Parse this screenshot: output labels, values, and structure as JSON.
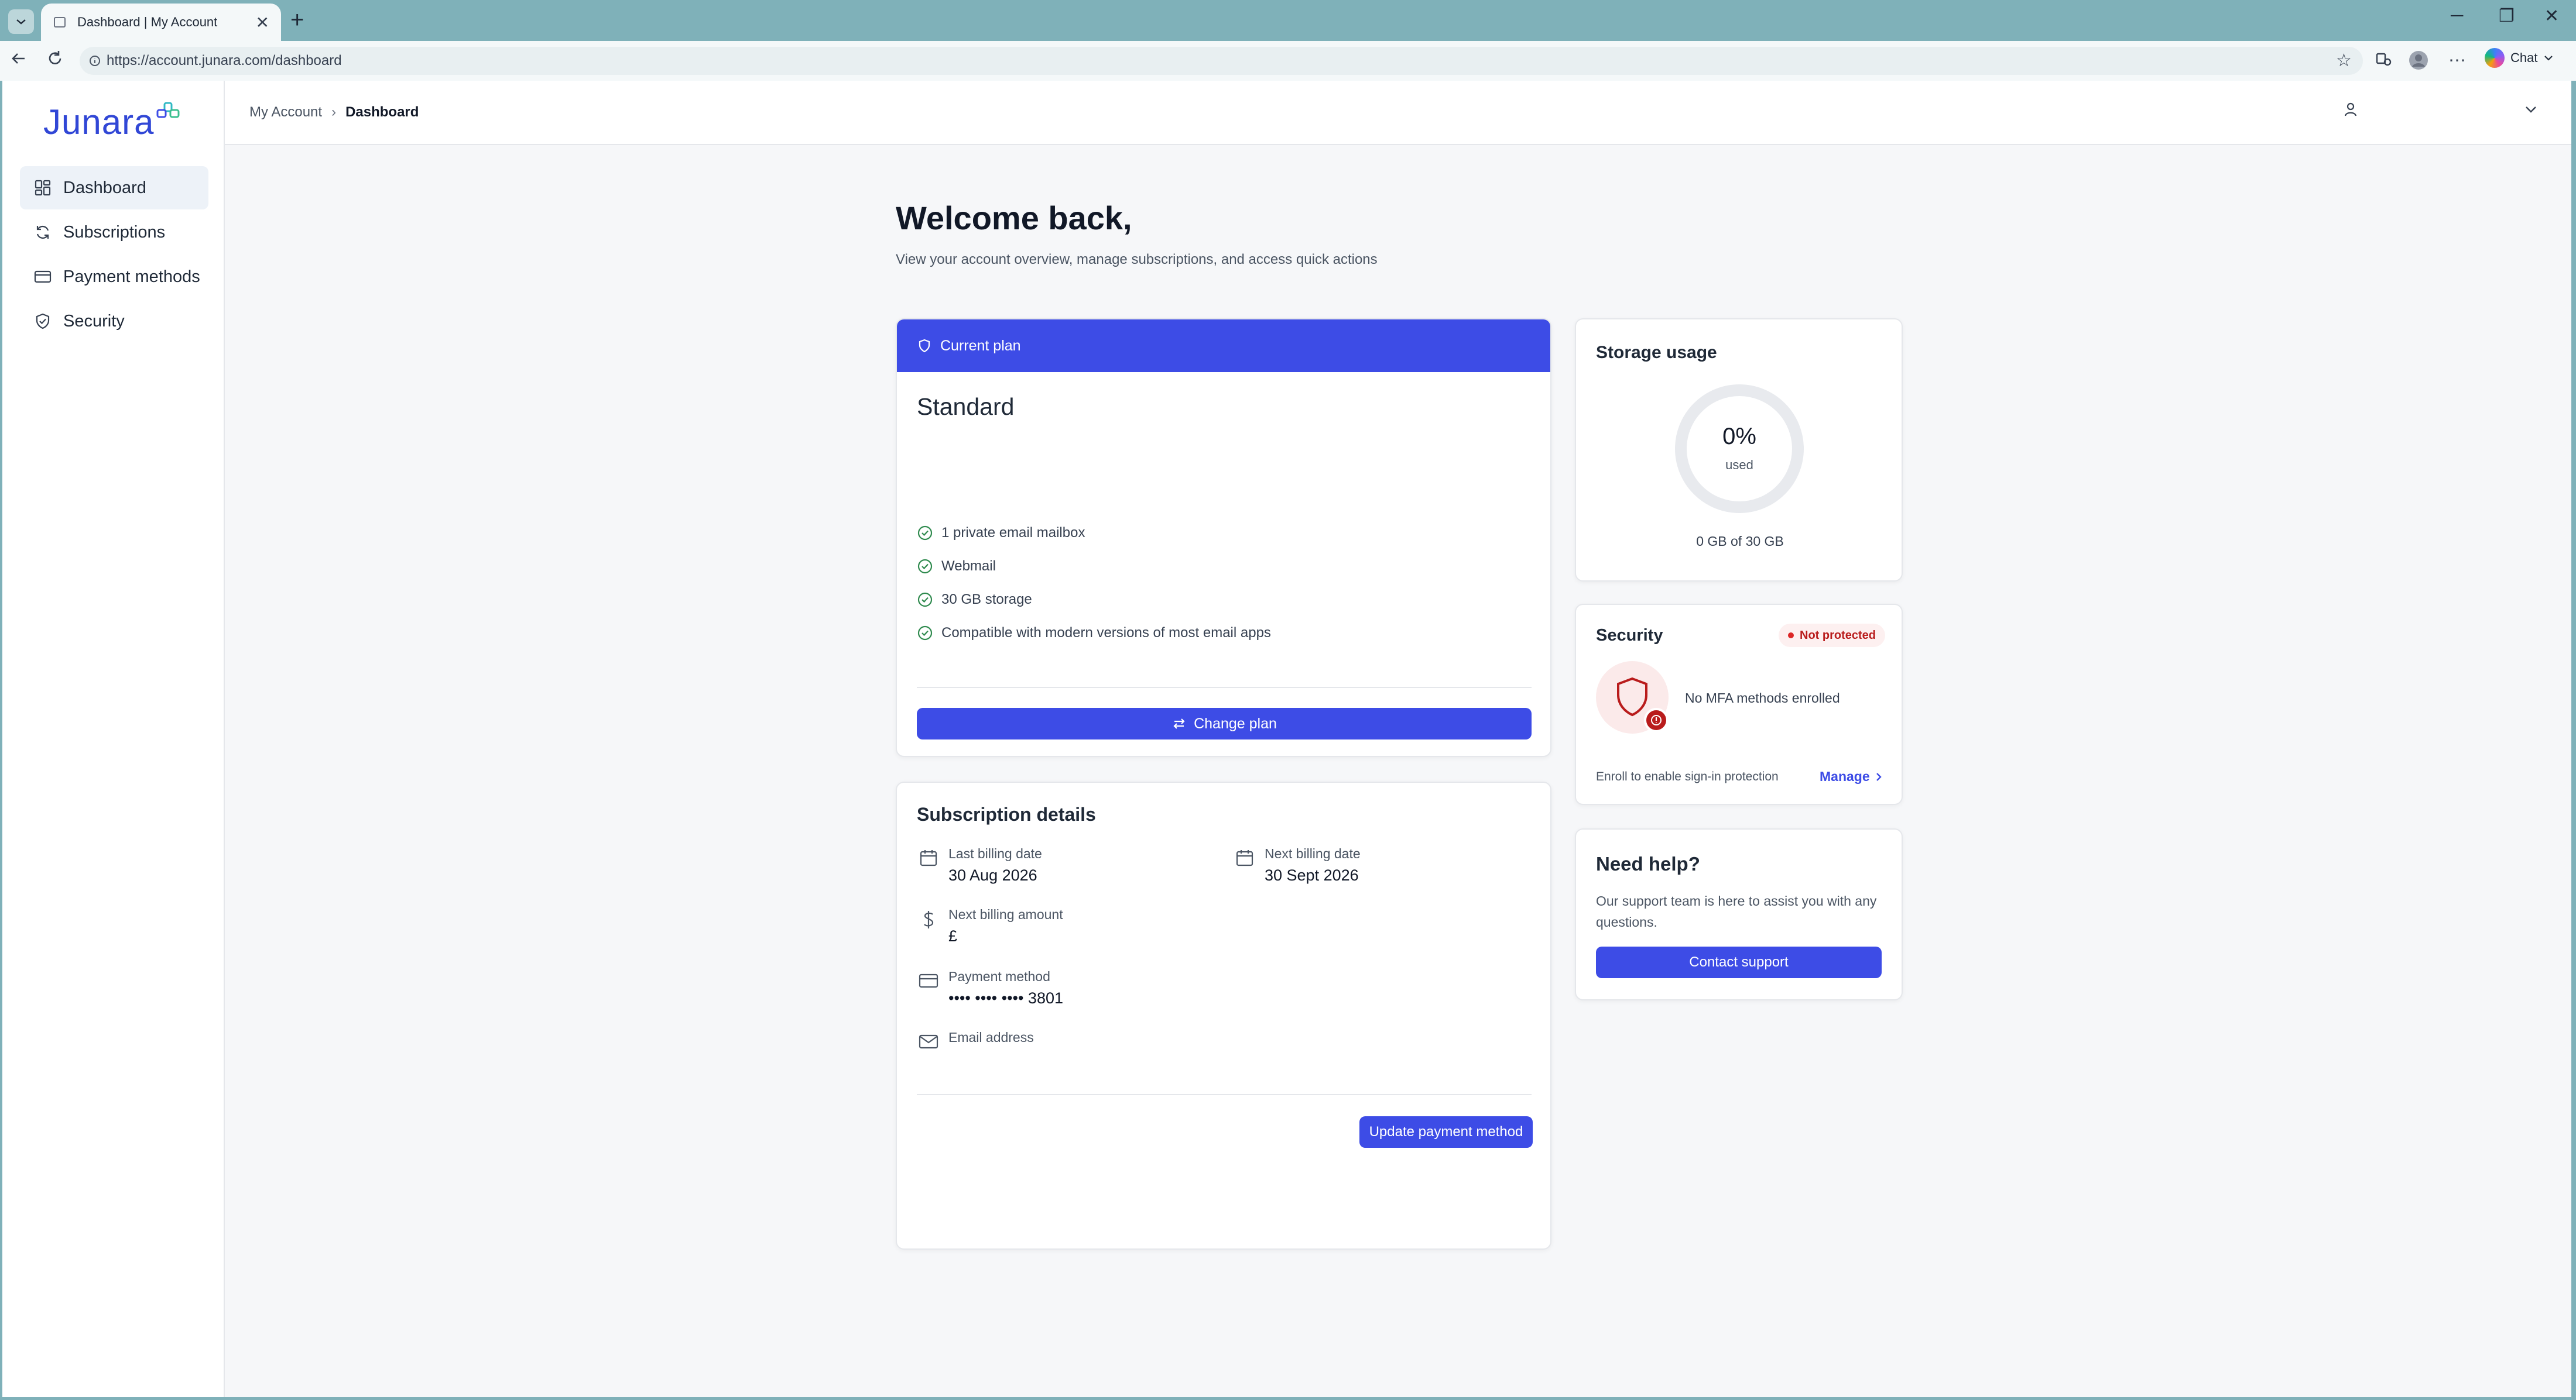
{
  "browser": {
    "tab_title": "Dashboard | My Account",
    "url": "https://account.junara.com/dashboard",
    "chat_label": "Chat"
  },
  "sidebar": {
    "logo_text": "Junara",
    "items": [
      {
        "label": "Dashboard",
        "icon": "dashboard-grid-icon",
        "active": true
      },
      {
        "label": "Subscriptions",
        "icon": "refresh-icon",
        "active": false
      },
      {
        "label": "Payment methods",
        "icon": "credit-card-icon",
        "active": false
      },
      {
        "label": "Security",
        "icon": "shield-check-icon",
        "active": false
      }
    ]
  },
  "header": {
    "breadcrumb_root": "My Account",
    "breadcrumb_current": "Dashboard"
  },
  "main": {
    "title": "Welcome back,",
    "subtitle": "View your account overview, manage subscriptions, and access quick actions"
  },
  "plan": {
    "header_label": "Current plan",
    "name": "Standard",
    "features": [
      "1 private email mailbox",
      "Webmail",
      "30 GB storage",
      "Compatible with modern versions of most email apps"
    ],
    "change_button": "Change plan"
  },
  "subscription": {
    "title": "Subscription details",
    "last_billing_label": "Last billing date",
    "last_billing_value": "30 Aug 2026",
    "next_billing_label": "Next billing date",
    "next_billing_value": "30 Sept 2026",
    "amount_label": "Next billing amount",
    "amount_value": "£",
    "payment_label": "Payment method",
    "payment_value": "•••• •••• •••• 3801",
    "email_label": "Email address",
    "email_value": "",
    "update_button": "Update payment method"
  },
  "storage": {
    "title": "Storage usage",
    "percent_text": "0%",
    "used_fraction": 0,
    "used_label": "used",
    "usage_text": "0 GB of 30 GB"
  },
  "security": {
    "title": "Security",
    "badge": "Not protected",
    "message": "No MFA methods enrolled",
    "footer": "Enroll to enable sign-in protection",
    "manage_link": "Manage"
  },
  "help": {
    "title": "Need help?",
    "text": "Our support team is here to assist you with any questions.",
    "button": "Contact support"
  },
  "colors": {
    "accent": "#3d4ce6",
    "danger": "#b91c1c",
    "success": "#2f8a4e",
    "chrome": "#7fb1b9"
  }
}
